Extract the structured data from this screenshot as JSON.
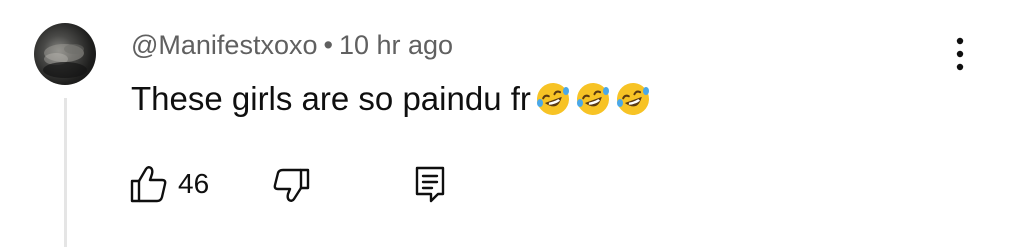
{
  "comment": {
    "author": "@Manifestxoxo",
    "separator": "•",
    "timestamp": "10 hr ago",
    "text": "These girls are so paindu fr",
    "emojis": [
      "rolling-on-floor-laughing-emoji",
      "rolling-on-floor-laughing-emoji",
      "rolling-on-floor-laughing-emoji"
    ],
    "like_count": "46"
  },
  "icons": {
    "like": "thumbs-up-icon",
    "dislike": "thumbs-down-icon",
    "reply": "reply-comment-icon",
    "more": "more-vertical-icon"
  },
  "colors": {
    "text_primary": "#0f0f0f",
    "text_secondary": "#606060",
    "thread_line": "#e5e5e5",
    "emoji_face": "#f7c325"
  }
}
